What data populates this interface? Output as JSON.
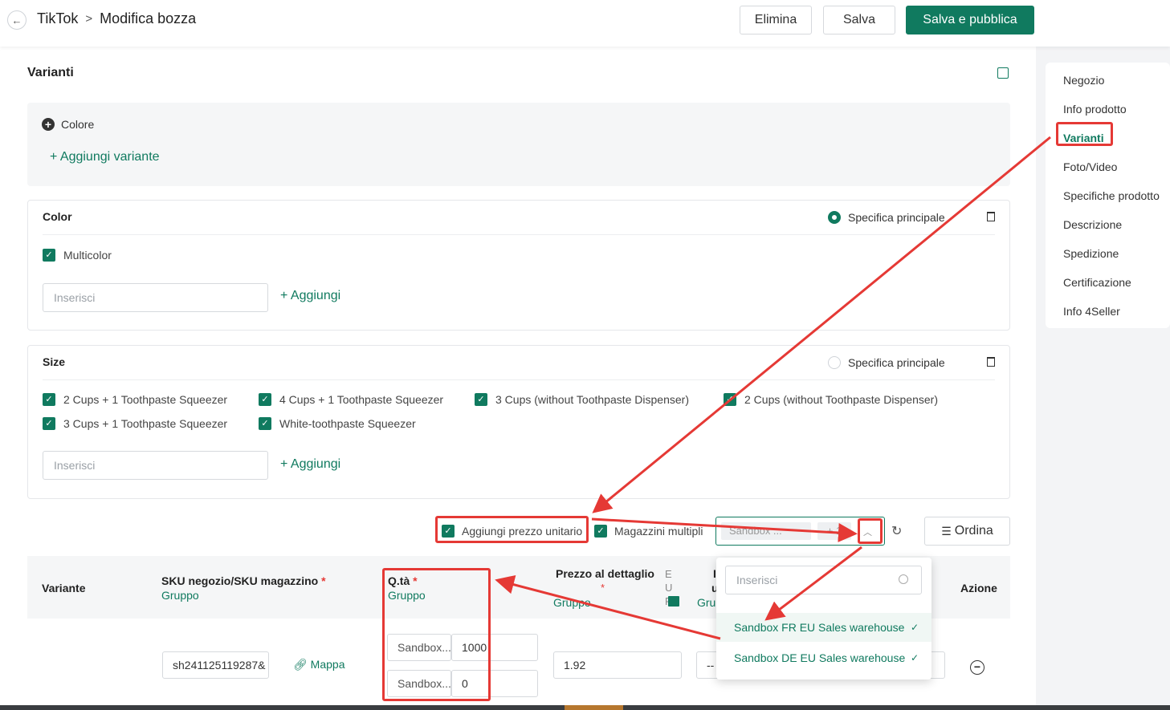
{
  "header": {
    "back_label": "←",
    "app": "TikTok",
    "separator": ">",
    "title": "Modifica bozza",
    "delete_label": "Elimina",
    "save_label": "Salva",
    "publish_label": "Salva e pubblica"
  },
  "sidebar": {
    "items": [
      {
        "label": "Negozio"
      },
      {
        "label": "Info prodotto"
      },
      {
        "label": "Varianti"
      },
      {
        "label": "Foto/Video"
      },
      {
        "label": "Specifiche prodotto"
      },
      {
        "label": "Descrizione"
      },
      {
        "label": "Spedizione"
      },
      {
        "label": "Certificazione"
      },
      {
        "label": "Info 4Seller"
      }
    ]
  },
  "variants": {
    "title": "Varianti",
    "color_option": "Colore",
    "add_variant": "+ Aggiungi variante",
    "color_card": {
      "title": "Color",
      "main_spec": "Specifica principale",
      "options": [
        "Multicolor"
      ],
      "placeholder": "Inserisci",
      "add": "+ Aggiungi"
    },
    "size_card": {
      "title": "Size",
      "main_spec": "Specifica principale",
      "options": [
        "2 Cups + 1 Toothpaste Squeezer",
        "4 Cups + 1 Toothpaste Squeezer",
        "3 Cups (without Toothpaste Dispenser)",
        "2 Cups (without Toothpaste Dispenser)",
        "3 Cups + 1 Toothpaste Squeezer",
        "White-toothpaste Squeezer"
      ],
      "placeholder": "Inserisci",
      "add": "+ Aggiungi"
    }
  },
  "toolbar": {
    "unit_price": "Aggiungi prezzo unitario",
    "multi_warehouse": "Magazzini multipli",
    "warehouse_select": "Sandbox ...",
    "warehouse_tag": "+ 1",
    "sort": "Ordina"
  },
  "table": {
    "headers": {
      "variant": "Variante",
      "sku": "SKU negozio/SKU magazzino",
      "sku_group": "Gruppo",
      "qty": "Q.tà",
      "qty_group": "Gruppo",
      "price": "Prezzo al dettaglio",
      "price_group": "Gruppo",
      "currency": "EUR",
      "col5_initial": "I",
      "col5_initial2": "u",
      "col5_group": "Gru",
      "action": "Azione"
    },
    "row": {
      "sku": "sh241125119287&",
      "map_label": "Mappa",
      "qty_rows": [
        {
          "warehouse": "Sandbox...",
          "qty": "1000"
        },
        {
          "warehouse": "Sandbox...",
          "qty": "0"
        }
      ],
      "price": "1.92",
      "col5": "--"
    }
  },
  "dropdown": {
    "placeholder": "Inserisci",
    "options": [
      {
        "label": "Sandbox FR EU Sales warehouse",
        "selected": true
      },
      {
        "label": "Sandbox DE EU Sales warehouse",
        "selected": true
      }
    ]
  },
  "colors": {
    "brand": "#107a5f",
    "annotation": "#e53935"
  }
}
